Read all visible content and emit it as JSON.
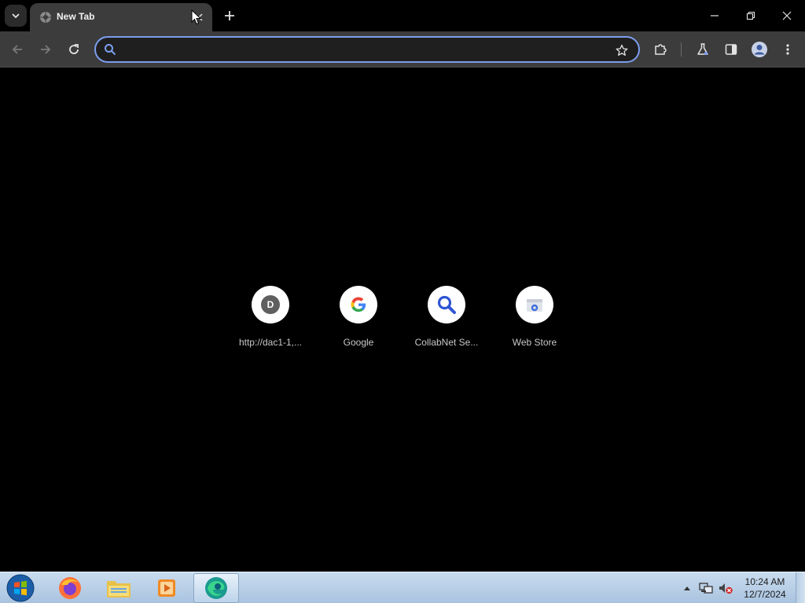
{
  "browser": {
    "tab": {
      "title": "New Tab",
      "favicon": "globe-icon"
    },
    "accent_color": "#7c9ef0",
    "omnibox": {
      "value": "",
      "placeholder": ""
    },
    "toolbar_icons": [
      "back-icon",
      "forward-icon",
      "reload-icon",
      "star-icon",
      "extensions-icon",
      "labs-flask-icon",
      "side-panel-icon",
      "profile-icon",
      "menu-icon"
    ],
    "window_controls": [
      "minimize-icon",
      "restore-icon",
      "close-icon"
    ]
  },
  "new_tab_page": {
    "background_color": "#000000",
    "shortcuts": [
      {
        "label": "http://dac1-1,...",
        "avatar_letter": "D",
        "icon": "letter-avatar"
      },
      {
        "label": "Google",
        "icon": "google-g-icon"
      },
      {
        "label": "CollabNet Se...",
        "icon": "search-magnifier-icon"
      },
      {
        "label": "Web Store",
        "icon": "web-store-icon"
      }
    ]
  },
  "taskbar": {
    "apps": [
      "windows-start-orb-icon",
      "firefox-icon",
      "file-explorer-icon",
      "media-player-icon",
      "edge-icon"
    ],
    "active_app": "edge-icon",
    "tray_icons": [
      "show-hidden-icons-arrow-icon",
      "network-icon",
      "volume-muted-icon"
    ],
    "clock": {
      "time": "10:24 AM",
      "date": "12/7/2024"
    }
  }
}
